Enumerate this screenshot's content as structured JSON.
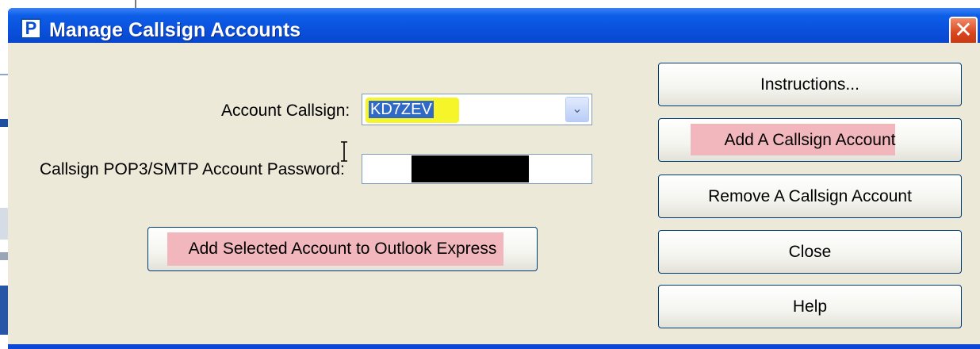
{
  "window": {
    "title": "Manage Callsign Accounts",
    "app_icon_glyph": "P",
    "close_glyph": "✕",
    "accent_color": "#0a4fdb",
    "highlight_yellow": "#f5f52a",
    "highlight_pink": "#f2b6bd"
  },
  "form": {
    "account_callsign_label": "Account Callsign:",
    "account_callsign_value": "KD7ZEV",
    "combo_arrow_glyph": "⌄",
    "password_label": "Callsign POP3/SMTP Account Password:"
  },
  "buttons": {
    "add_to_outlook": "Add Selected Account to Outlook Express",
    "instructions": "Instructions...",
    "add_account": "Add A Callsign Account",
    "remove_account": "Remove A Callsign Account",
    "close": "Close",
    "help": "Help"
  }
}
